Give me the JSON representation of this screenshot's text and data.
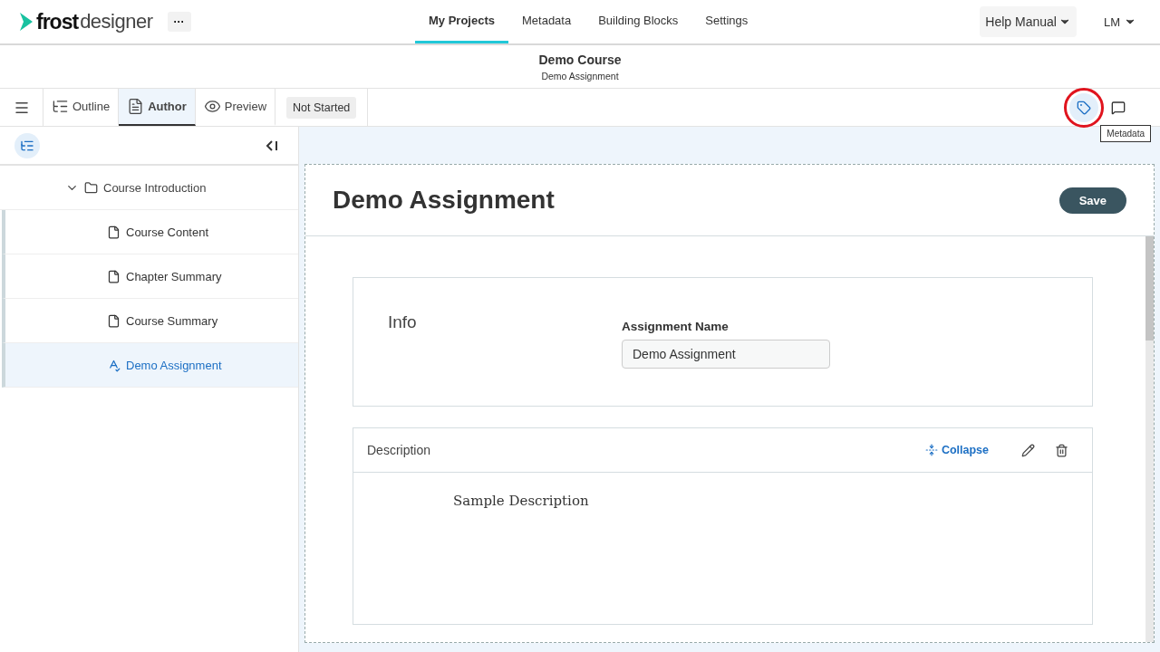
{
  "header": {
    "logo": {
      "bold": "frost",
      "light": "designer"
    },
    "more": "···",
    "nav": [
      {
        "label": "My Projects",
        "selected": true
      },
      {
        "label": "Metadata",
        "selected": false
      },
      {
        "label": "Building Blocks",
        "selected": false
      },
      {
        "label": "Settings",
        "selected": false
      }
    ],
    "help": "Help Manual",
    "user": "LM"
  },
  "course": {
    "title": "Demo Course",
    "subtitle": "Demo Assignment"
  },
  "toolbar": {
    "tabs": [
      {
        "label": "Outline",
        "kind": "outline",
        "selected": false
      },
      {
        "label": "Author",
        "kind": "author",
        "selected": true
      },
      {
        "label": "Preview",
        "kind": "preview",
        "selected": false
      }
    ],
    "status": "Not Started",
    "tools": [
      {
        "kind": "tag",
        "selected": true,
        "highlighted": true
      },
      {
        "kind": "comment",
        "selected": false,
        "highlighted": false
      }
    ],
    "tooltip": "Metadata"
  },
  "sidebar": {
    "tree": [
      {
        "label": "Course Introduction",
        "kind": "folder",
        "expanded": true,
        "children": [
          {
            "label": "Course Content",
            "kind": "page",
            "selected": false
          },
          {
            "label": "Chapter Summary",
            "kind": "page",
            "selected": false
          },
          {
            "label": "Course Summary",
            "kind": "page",
            "selected": false
          },
          {
            "label": "Demo Assignment",
            "kind": "assignment",
            "selected": true
          }
        ]
      }
    ]
  },
  "editor": {
    "title": "Demo Assignment",
    "save": "Save",
    "info": {
      "heading": "Info",
      "field_label": "Assignment Name",
      "field_value": "Demo Assignment"
    },
    "description": {
      "heading": "Description",
      "collapse": "Collapse",
      "body": "Sample Description"
    }
  }
}
